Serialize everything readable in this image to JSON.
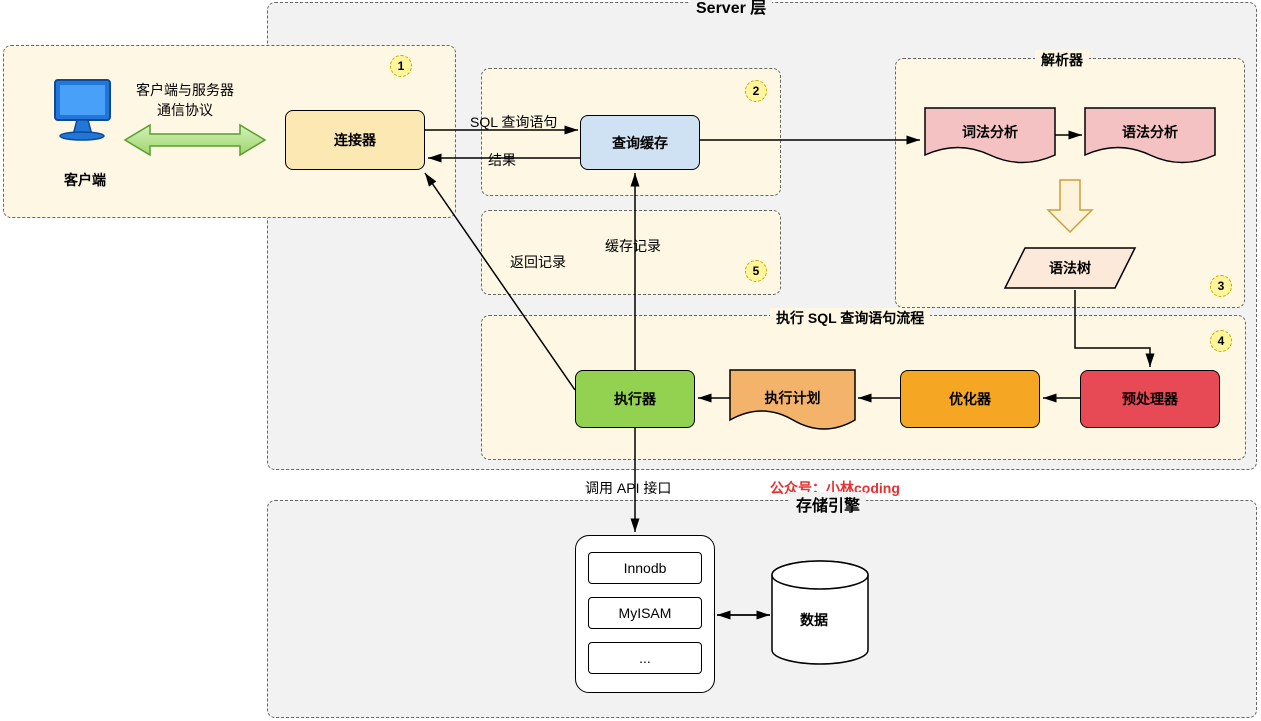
{
  "server_layer_title": "Server 层",
  "storage_layer_title": "存储引擎",
  "client_label": "客户端",
  "client_comm_label1": "客户端与服务器",
  "client_comm_label2": "通信协议",
  "connector_label": "连接器",
  "query_cache_label": "查询缓存",
  "parser_title": "解析器",
  "lex_label": "词法分析",
  "syntax_label": "语法分析",
  "syntax_tree_label": "语法树",
  "exec_flow_title": "执行 SQL 查询语句流程",
  "preprocessor_label": "预处理器",
  "optimizer_label": "优化器",
  "exec_plan_label": "执行计划",
  "executor_label": "执行器",
  "sql_query_label": "SQL 查询语句",
  "result_label": "结果",
  "cache_record_label": "缓存记录",
  "return_record_label": "返回记录",
  "api_call_label": "调用 API 接口",
  "innodb_label": "Innodb",
  "myisam_label": "MyISAM",
  "ellipsis_label": "...",
  "data_label": "数据",
  "credit_label": "公众号：小林coding",
  "badge1": "1",
  "badge2": "2",
  "badge3": "3",
  "badge4": "4",
  "badge5": "5"
}
